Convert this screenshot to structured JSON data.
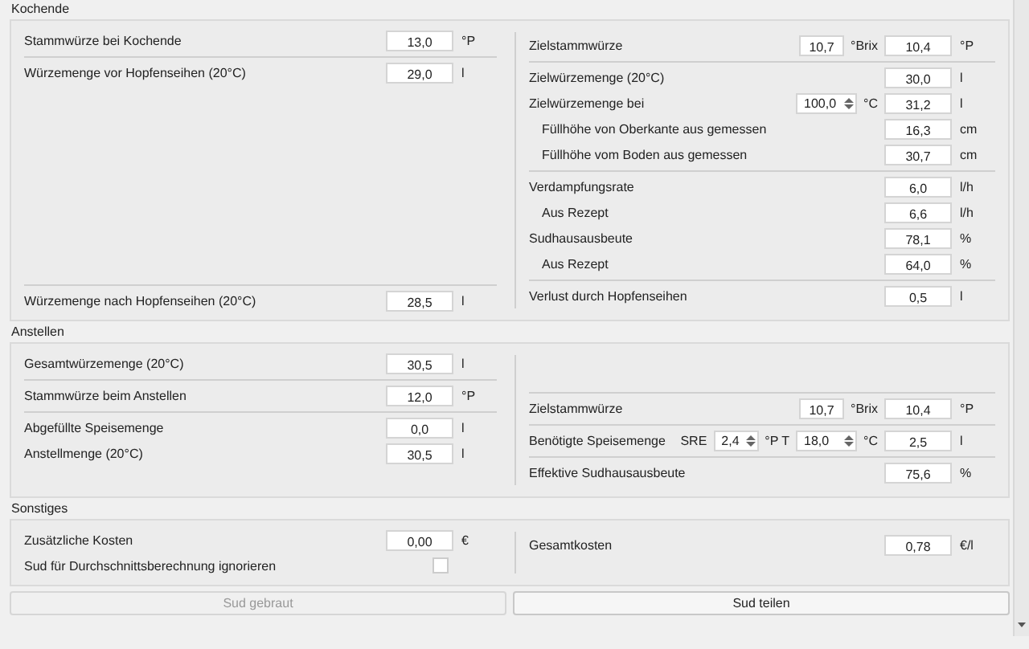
{
  "sections": [
    {
      "title": "Kochende",
      "columns": [
        [
          [
            {
              "label": "Stammwürze bei Kochende",
              "controls": [
                {
                  "kind": "field",
                  "value": "13,0"
                },
                {
                  "kind": "text",
                  "text": "°P"
                }
              ]
            }
          ],
          [
            {
              "label": "Würzemenge vor Hopfenseihen (20°C)",
              "controls": [
                {
                  "kind": "field",
                  "value": "29,0"
                },
                {
                  "kind": "text",
                  "text": "l"
                }
              ]
            }
          ],
          [
            {
              "label": "Würzemenge nach Hopfenseihen (20°C)",
              "controls": [
                {
                  "kind": "field",
                  "value": "28,5"
                },
                {
                  "kind": "text",
                  "text": "l"
                }
              ]
            }
          ]
        ],
        [
          [
            {
              "label": "Zielstammwürze",
              "controls": [
                {
                  "kind": "field",
                  "value": "10,7"
                },
                {
                  "kind": "text",
                  "text": "°Brix"
                },
                {
                  "kind": "field",
                  "value": "10,4"
                },
                {
                  "kind": "text",
                  "text": "°P"
                }
              ]
            }
          ],
          [
            {
              "label": "Zielwürzemenge (20°C)",
              "controls": [
                {
                  "kind": "field",
                  "value": "30,0"
                },
                {
                  "kind": "text",
                  "text": "l"
                }
              ]
            },
            {
              "label": "Zielwürzemenge bei",
              "controls": [
                {
                  "kind": "spin",
                  "value": "100,0"
                },
                {
                  "kind": "text",
                  "text": "°C"
                },
                {
                  "kind": "field",
                  "value": "31,2"
                },
                {
                  "kind": "text",
                  "text": "l"
                }
              ]
            },
            {
              "label": "Füllhöhe von Oberkante aus gemessen",
              "indent": true,
              "controls": [
                {
                  "kind": "field",
                  "value": "16,3"
                },
                {
                  "kind": "text",
                  "text": "cm"
                }
              ]
            },
            {
              "label": "Füllhöhe vom Boden aus gemessen",
              "indent": true,
              "controls": [
                {
                  "kind": "field",
                  "value": "30,7"
                },
                {
                  "kind": "text",
                  "text": "cm"
                }
              ]
            }
          ],
          [
            {
              "label": "Verdampfungsrate",
              "controls": [
                {
                  "kind": "field",
                  "value": "6,0"
                },
                {
                  "kind": "text",
                  "text": "l/h"
                }
              ]
            },
            {
              "label": "Aus Rezept",
              "indent": true,
              "controls": [
                {
                  "kind": "field",
                  "value": "6,6"
                },
                {
                  "kind": "text",
                  "text": "l/h"
                }
              ]
            },
            {
              "label": "Sudhausausbeute",
              "controls": [
                {
                  "kind": "field",
                  "value": "78,1"
                },
                {
                  "kind": "text",
                  "text": "%"
                }
              ]
            },
            {
              "label": "Aus Rezept",
              "indent": true,
              "controls": [
                {
                  "kind": "field",
                  "value": "64,0"
                },
                {
                  "kind": "text",
                  "text": "%"
                }
              ]
            }
          ],
          [
            {
              "label": "Verlust durch Hopfenseihen",
              "controls": [
                {
                  "kind": "field",
                  "value": "0,5"
                },
                {
                  "kind": "text",
                  "text": "l"
                }
              ]
            }
          ]
        ]
      ]
    },
    {
      "title": "Anstellen",
      "columns": [
        [
          [
            {
              "label": "Gesamtwürzemenge (20°C)",
              "controls": [
                {
                  "kind": "field",
                  "value": "30,5"
                },
                {
                  "kind": "text",
                  "text": "l"
                }
              ]
            }
          ],
          [
            {
              "label": "Stammwürze beim Anstellen",
              "controls": [
                {
                  "kind": "field",
                  "value": "12,0"
                },
                {
                  "kind": "text",
                  "text": "°P"
                }
              ]
            }
          ],
          [
            {
              "label": "Abgefüllte Speisemenge",
              "controls": [
                {
                  "kind": "field",
                  "value": "0,0"
                },
                {
                  "kind": "text",
                  "text": "l"
                }
              ]
            },
            {
              "label": "Anstellmenge (20°C)",
              "controls": [
                {
                  "kind": "field",
                  "value": "30,5"
                },
                {
                  "kind": "text",
                  "text": "l"
                }
              ]
            }
          ]
        ],
        [
          [
            {
              "label": "Zielstammwürze",
              "controls": [
                {
                  "kind": "field",
                  "value": "10,7"
                },
                {
                  "kind": "text",
                  "text": "°Brix"
                },
                {
                  "kind": "field",
                  "value": "10,4"
                },
                {
                  "kind": "text",
                  "text": "°P"
                }
              ]
            }
          ],
          [
            {
              "label": "Benötigte Speisemenge",
              "controls": [
                {
                  "kind": "text",
                  "text": "SRE"
                },
                {
                  "kind": "spin",
                  "value": "2,4"
                },
                {
                  "kind": "text",
                  "text": "°P T"
                },
                {
                  "kind": "spin",
                  "value": "18,0"
                },
                {
                  "kind": "text",
                  "text": "°C"
                },
                {
                  "kind": "field",
                  "value": "2,5"
                },
                {
                  "kind": "text",
                  "text": "l"
                }
              ]
            }
          ],
          [
            {
              "label": "Effektive Sudhausausbeute",
              "controls": [
                {
                  "kind": "field",
                  "value": "75,6"
                },
                {
                  "kind": "text",
                  "text": "%"
                }
              ]
            }
          ]
        ]
      ]
    },
    {
      "title": "Sonstiges",
      "columns": [
        [
          [
            {
              "label": "Zusätzliche Kosten",
              "controls": [
                {
                  "kind": "field",
                  "value": "0,00"
                },
                {
                  "kind": "text",
                  "text": "€"
                }
              ]
            },
            {
              "label": "Sud für Durchschnittsberechnung ignorieren",
              "controls": [
                {
                  "kind": "checkbox",
                  "checked": false
                }
              ]
            }
          ]
        ],
        [
          [
            {
              "label": "Gesamtkosten",
              "controls": [
                {
                  "kind": "field",
                  "value": "0,78"
                },
                {
                  "kind": "text",
                  "text": "€/l"
                }
              ]
            }
          ]
        ]
      ]
    }
  ],
  "buttons": [
    {
      "label": "Sud gebraut",
      "disabled": true
    },
    {
      "label": "Sud teilen",
      "disabled": false
    }
  ]
}
